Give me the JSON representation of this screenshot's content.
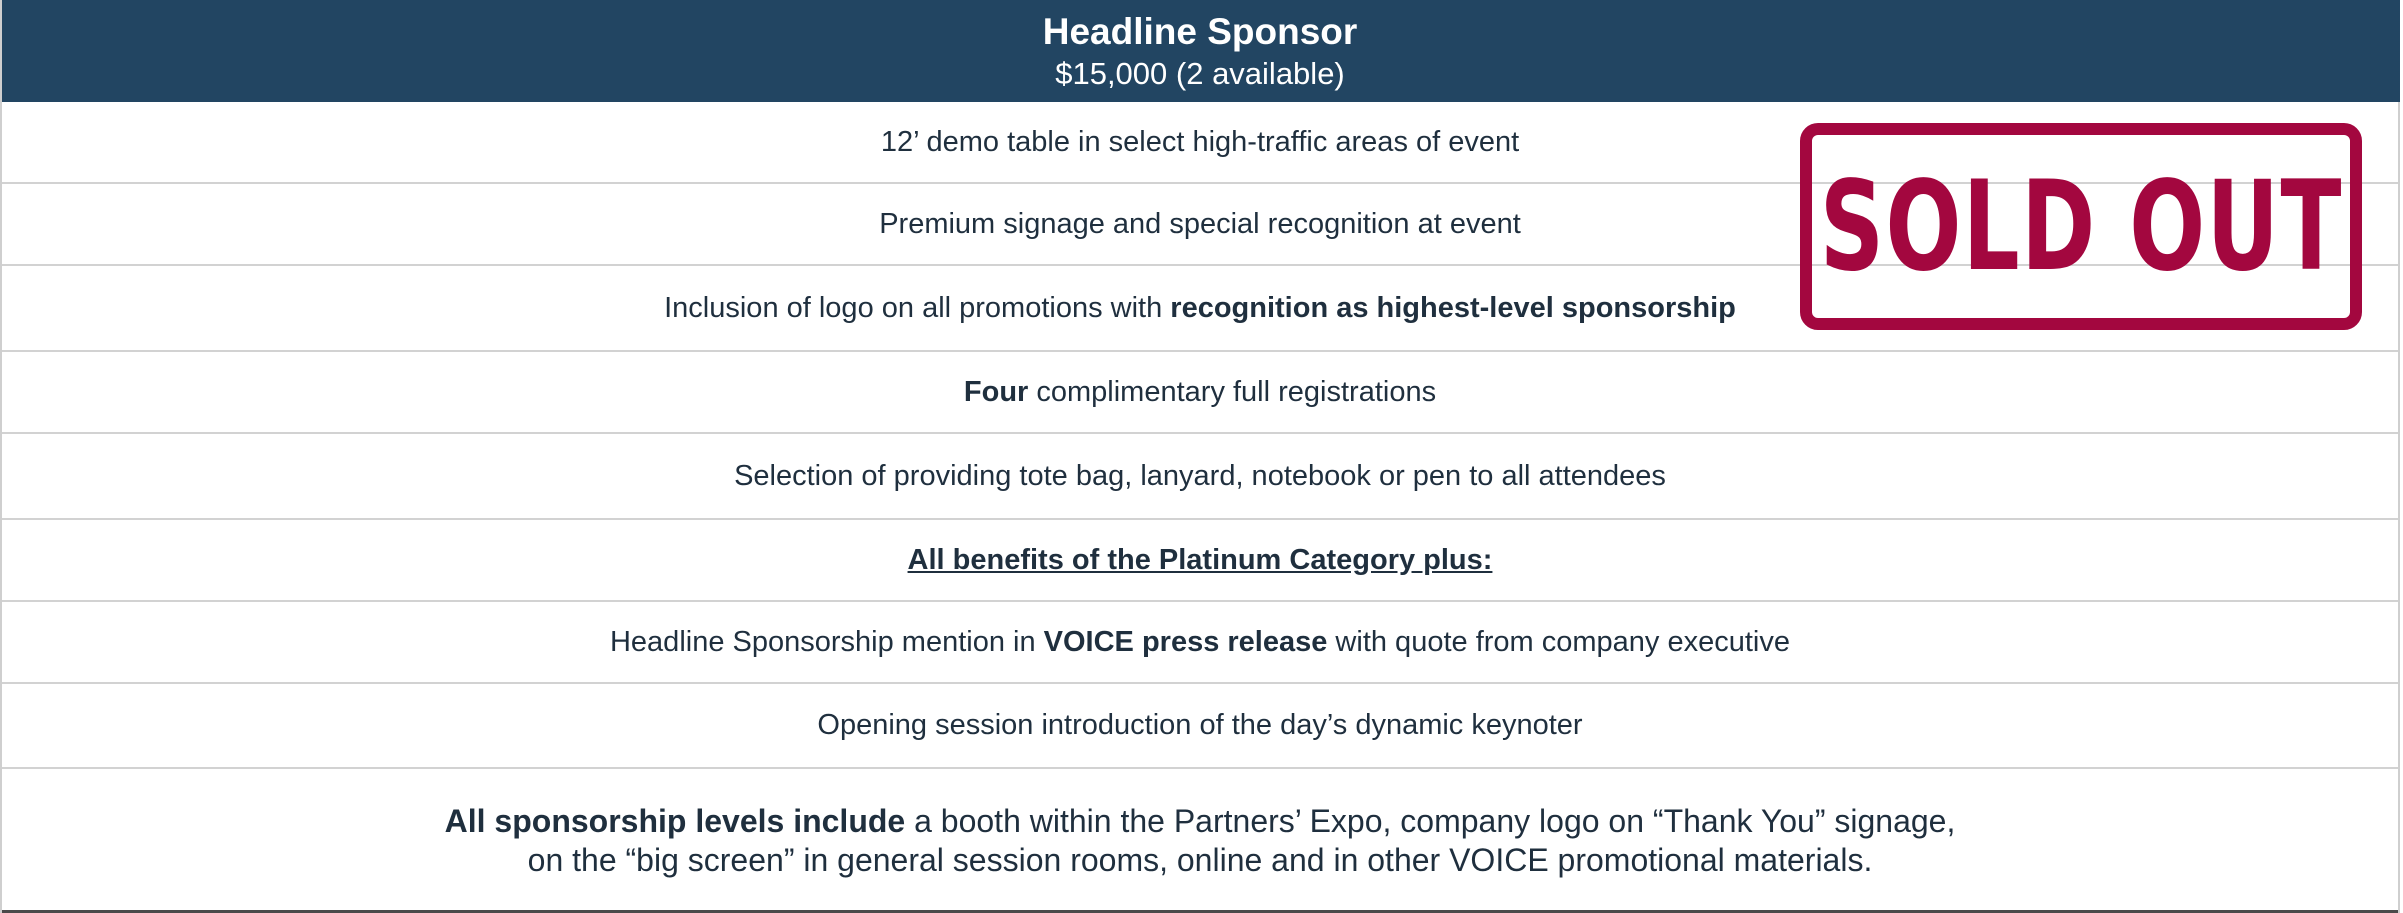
{
  "header": {
    "title": "Headline Sponsor",
    "price": "$15,000 (2 available)"
  },
  "benefits": [
    {
      "text": "12’ demo table in select high-traffic areas of event"
    },
    {
      "text": "Premium signage and special recognition at event"
    },
    {
      "pre": "Inclusion of logo on all promotions with ",
      "bold": "recognition as highest-level sponsorship",
      "post": ""
    },
    {
      "pre": "",
      "bold": "Four",
      "post": " complimentary full registrations"
    },
    {
      "text": "Selection of providing tote bag, lanyard, notebook or pen to all attendees"
    },
    {
      "underlined": "All benefits of the Platinum Category plus:"
    },
    {
      "pre": "Headline Sponsorship mention in ",
      "bold": "VOICE press release",
      "post": " with quote from company executive"
    },
    {
      "text": "Opening session introduction of the day’s dynamic keynoter"
    }
  ],
  "footer": {
    "bold": "All sponsorship levels include",
    "line1_rest": " a booth within the Partners’ Expo, company logo on “Thank You” signage,",
    "line2": "on the “big screen” in general session rooms, online and in other VOICE promotional materials."
  },
  "stamp": {
    "text": "SOLD OUT",
    "color": "#a3073f"
  },
  "colors": {
    "header_bg": "#224562",
    "text": "#1f2f3e"
  }
}
